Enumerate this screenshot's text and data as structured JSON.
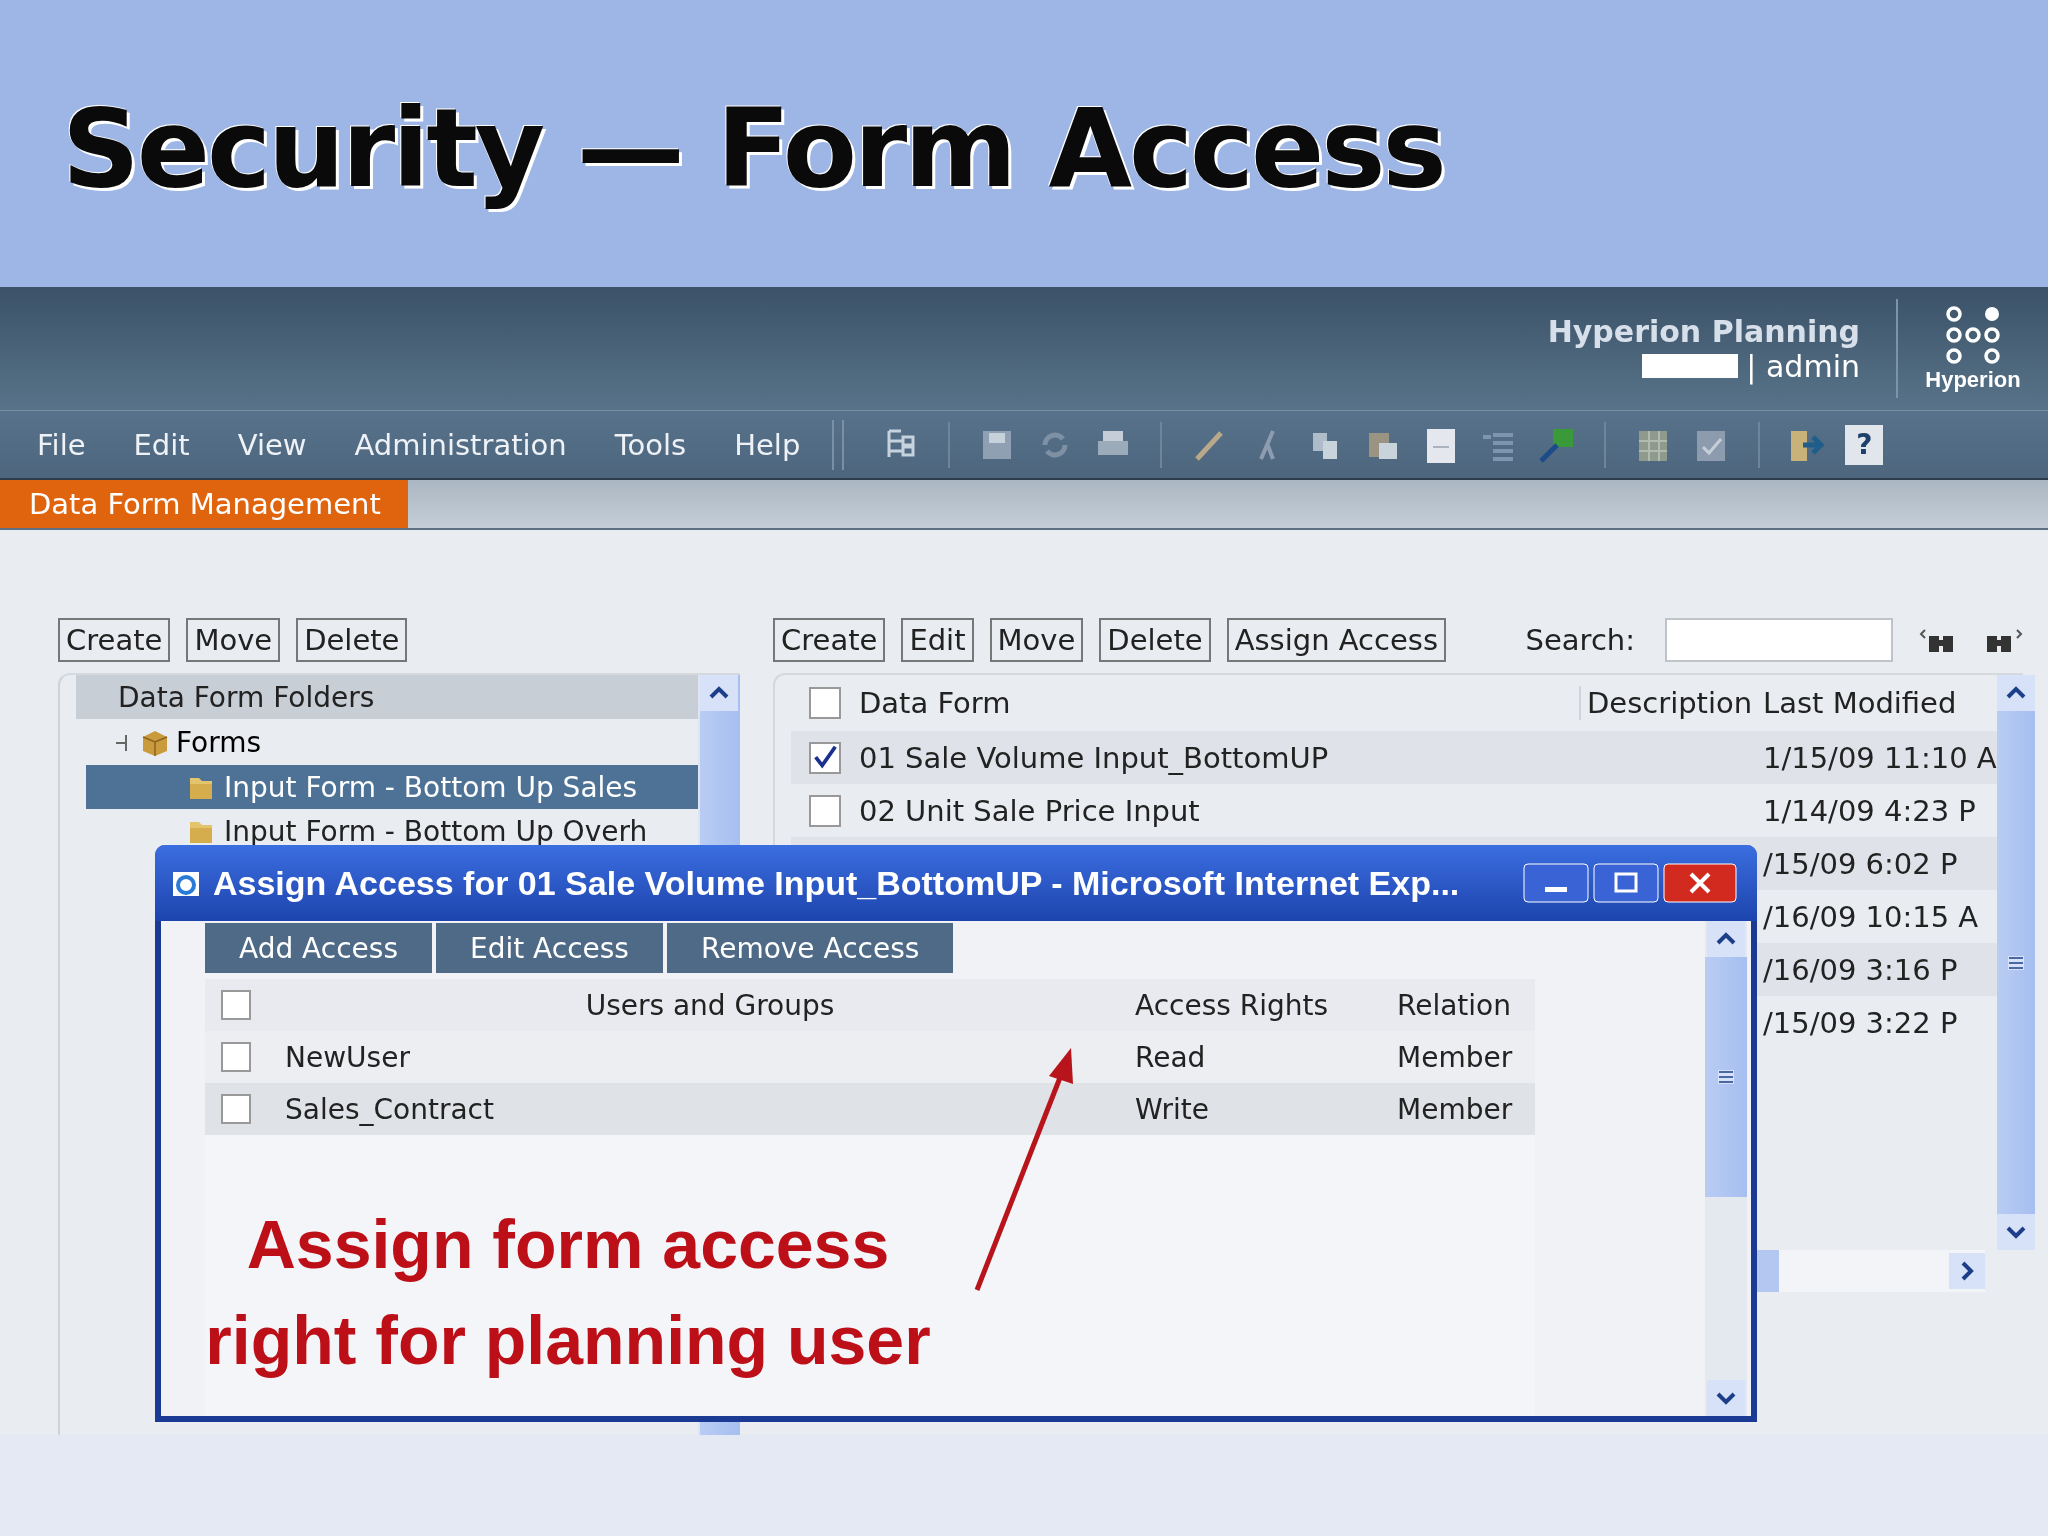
{
  "slide": {
    "title": "Security — Form Access"
  },
  "app": {
    "product": "Hyperion Planning",
    "user": "| admin",
    "logo_text": "Hyperion"
  },
  "menu": [
    "File",
    "Edit",
    "View",
    "Administration",
    "Tools",
    "Help"
  ],
  "toolbar": {
    "help_glyph": "?"
  },
  "module_tab": {
    "label": "Data Form Management"
  },
  "folders_panel": {
    "buttons": [
      "Create",
      "Move",
      "Delete"
    ],
    "header": "Data Form Folders",
    "tree": [
      {
        "label": "Forms",
        "expanded": true,
        "selected": false,
        "children": [
          {
            "label": "Input Form - Bottom Up Sales",
            "selected": true
          },
          {
            "label": "Input Form - Bottom Up Overh",
            "selected": false
          }
        ]
      }
    ]
  },
  "forms_panel": {
    "buttons": [
      "Create",
      "Edit",
      "Move",
      "Delete",
      "Assign Access"
    ],
    "search": {
      "label": "Search:"
    },
    "all_checked": false,
    "columns": [
      "Data Form",
      "Description",
      "Last Modified"
    ],
    "rows": [
      {
        "name": "01 Sale Volume Input_BottomUP",
        "modified": "1/15/09 11:10 A",
        "checked": true
      },
      {
        "name": "02 Unit Sale Price Input",
        "modified": "1/14/09 4:23 P",
        "checked": false
      },
      {
        "modified": "/15/09 6:02 P"
      },
      {
        "modified": "/16/09 10:15 A"
      },
      {
        "modified": "/16/09 3:16 P"
      },
      {
        "modified": "/15/09 3:22 P"
      }
    ]
  },
  "dialog": {
    "title": "Assign Access for 01 Sale Volume Input_BottomUP - Microsoft Internet Exp...",
    "buttons": [
      "Add Access",
      "Edit Access",
      "Remove Access"
    ],
    "all_checked": false,
    "columns": [
      "Users and Groups",
      "Access Rights",
      "Relation"
    ],
    "rows": [
      {
        "name": "NewUser",
        "rights": "Read",
        "relation": "Member",
        "checked": false
      },
      {
        "name": "Sales_Contract",
        "rights": "Write",
        "relation": "Member",
        "checked": false
      }
    ]
  },
  "annotation": {
    "text": "Assign form access right for planning user"
  }
}
